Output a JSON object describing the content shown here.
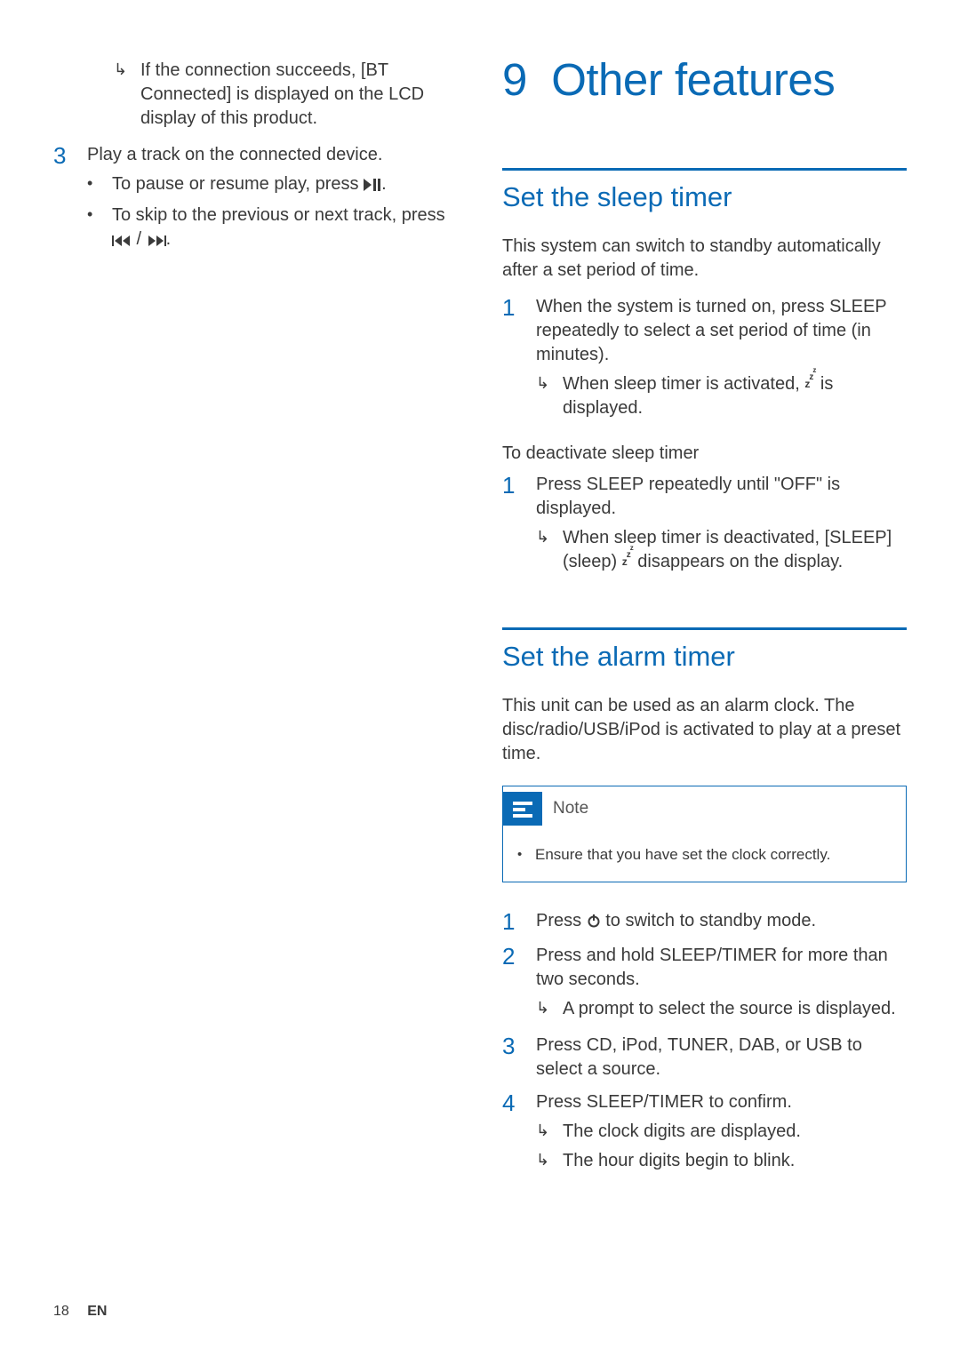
{
  "left": {
    "connection_result": "If the connection succeeds, [BT Connected] is displayed on the LCD display of this product.",
    "step3_num": "3",
    "step3_text": "Play a track on the connected device.",
    "step3_b1_pre": "To pause or resume play, press ",
    "step3_b1_post": ".",
    "step3_b2_pre": "To skip to the previous or next track, press ",
    "step3_b2_mid": " / ",
    "step3_b2_post": "."
  },
  "chapter": {
    "num": "9",
    "title": "Other features"
  },
  "sleep": {
    "heading": "Set the sleep timer",
    "intro": "This system can switch to standby automatically after a set period of time.",
    "s1_num": "1",
    "s1_pre": "When the system is turned on, press ",
    "s1_bold": "SLEEP",
    "s1_post": " repeatedly to select a set period of time (in minutes).",
    "s1_r1_pre": "When sleep timer is activated, ",
    "s1_r1_post": " is displayed.",
    "deact_heading": "To deactivate sleep timer",
    "d1_num": "1",
    "d1_pre": "Press ",
    "d1_bold": "SLEEP",
    "d1_post": " repeatedly until \"OFF\" is displayed.",
    "d1_r1_pre": "When sleep timer is deactivated, [SLEEP](sleep) ",
    "d1_r1_post": " disappears on the display."
  },
  "alarm": {
    "heading": "Set the alarm timer",
    "intro": "This unit can be used as an alarm clock. The disc/radio/USB/iPod is activated to play at a preset time.",
    "note_label": "Note",
    "note_b1": "Ensure that you have set the clock correctly.",
    "s1_num": "1",
    "s1_pre": "Press ",
    "s1_post": " to switch to standby mode.",
    "s2_num": "2",
    "s2_pre": "Press and hold ",
    "s2_bold": "SLEEP/TIMER",
    "s2_post": " for more than two seconds.",
    "s2_r1": "A prompt to select the source is displayed.",
    "s3_num": "3",
    "s3_pre": "Press ",
    "s3_cd": "CD",
    "s3_c1": ", ",
    "s3_ipod": "iPod",
    "s3_c2": ", ",
    "s3_tuner": "TUNER",
    "s3_c3": ", ",
    "s3_dab": "DAB",
    "s3_c4": ", or ",
    "s3_usb": "USB",
    "s3_post": " to select a source.",
    "s4_num": "4",
    "s4_pre": "Press ",
    "s4_bold": "SLEEP/TIMER",
    "s4_post": " to confirm.",
    "s4_r1": "The clock digits are displayed.",
    "s4_r2": "The hour digits begin to blink."
  },
  "footer": {
    "page": "18",
    "lang": "EN"
  }
}
